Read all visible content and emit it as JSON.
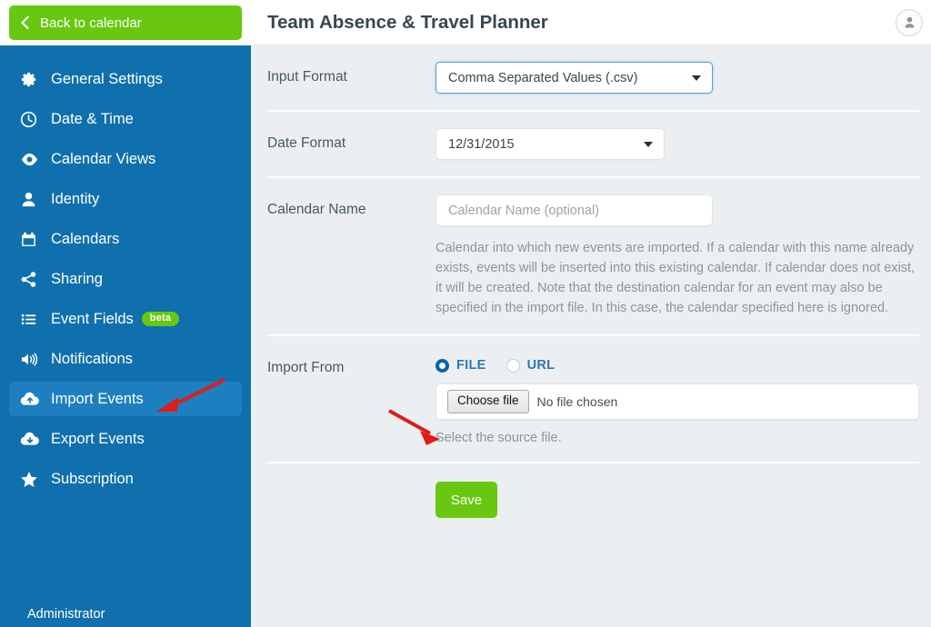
{
  "sidebar": {
    "back_button": {
      "label": "Back to calendar",
      "icon": "chevron-left-icon"
    },
    "items": [
      {
        "label": "General Settings",
        "icon": "gear-icon",
        "active": false,
        "badge": null
      },
      {
        "label": "Date & Time",
        "icon": "clock-icon",
        "active": false,
        "badge": null
      },
      {
        "label": "Calendar Views",
        "icon": "eye-icon",
        "active": false,
        "badge": null
      },
      {
        "label": "Identity",
        "icon": "person-icon",
        "active": false,
        "badge": null
      },
      {
        "label": "Calendars",
        "icon": "calendar-icon",
        "active": false,
        "badge": null
      },
      {
        "label": "Sharing",
        "icon": "share-icon",
        "active": false,
        "badge": null
      },
      {
        "label": "Event Fields",
        "icon": "list-icon",
        "active": false,
        "badge": "beta"
      },
      {
        "label": "Notifications",
        "icon": "speaker-icon",
        "active": false,
        "badge": null
      },
      {
        "label": "Import Events",
        "icon": "cloud-upload-icon",
        "active": true,
        "badge": null
      },
      {
        "label": "Export Events",
        "icon": "cloud-download-icon",
        "active": false,
        "badge": null
      },
      {
        "label": "Subscription",
        "icon": "star-icon",
        "active": false,
        "badge": null
      }
    ],
    "footer_user": "Administrator",
    "accent_green": "#68c811",
    "background_blue": "#1070ad",
    "active_blue": "#1d7fc0"
  },
  "header": {
    "title": "Team Absence & Travel Planner",
    "avatar_icon": "user-avatar-icon"
  },
  "form": {
    "input_format": {
      "label": "Input Format",
      "value": "Comma Separated Values (.csv)"
    },
    "date_format": {
      "label": "Date Format",
      "value": "12/31/2015"
    },
    "calendar_name": {
      "label": "Calendar Name",
      "value": "",
      "placeholder": "Calendar Name (optional)",
      "help": "Calendar into which new events are imported. If a calendar with this name already exists, events will be inserted into this existing calendar. If calendar does not exist, it will be created. Note that the destination calendar for an event may also be specified in the import file. In this case, the calendar specified here is ignored."
    },
    "import_from": {
      "label": "Import From",
      "options": [
        {
          "label": "FILE",
          "selected": true
        },
        {
          "label": "URL",
          "selected": false
        }
      ],
      "choose_file_label": "Choose file",
      "file_status": "No file chosen",
      "note": "Select the source file."
    },
    "save_label": "Save"
  },
  "annotations": {
    "arrow_color": "#e01b1b",
    "arrows": [
      {
        "name": "arrow-to-import-events"
      },
      {
        "name": "arrow-to-file-radio"
      }
    ]
  }
}
